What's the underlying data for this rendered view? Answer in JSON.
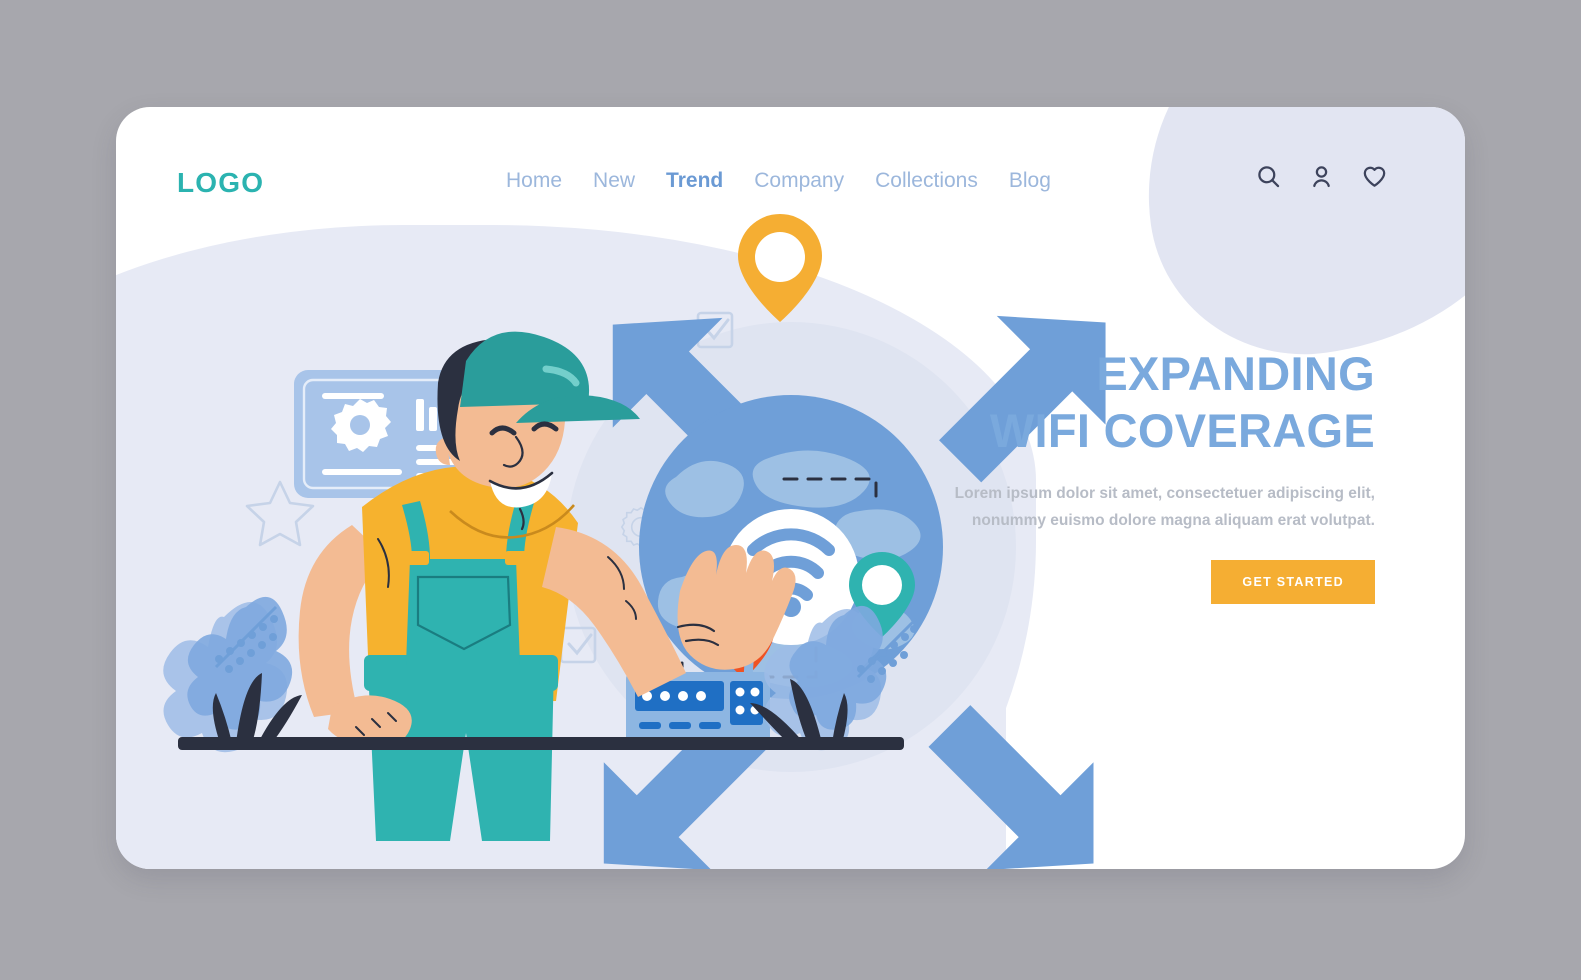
{
  "page": {
    "background_color": "#a7a7ad",
    "card_color": "#ffffff",
    "blob_color": "#e7eaf5"
  },
  "header": {
    "logo": "LOGO",
    "logo_color": "#2bb3b0",
    "nav": [
      {
        "label": "Home",
        "active": false
      },
      {
        "label": "New",
        "active": false
      },
      {
        "label": "Trend",
        "active": true
      },
      {
        "label": "Company",
        "active": false
      },
      {
        "label": "Collections",
        "active": false
      },
      {
        "label": "Blog",
        "active": false
      }
    ],
    "nav_color": "#9cb7dc",
    "nav_active_color": "#6b9ad4",
    "icons": [
      {
        "name": "search-icon",
        "label": "Search"
      },
      {
        "name": "user-icon",
        "label": "Account"
      },
      {
        "name": "heart-icon",
        "label": "Favorites"
      }
    ],
    "icon_color": "#3d435c"
  },
  "hero": {
    "title_line1": "EXPANDING",
    "title_line2": "WIFI COVERAGE",
    "title_color": "#7aa9dd",
    "body": "Lorem ipsum dolor sit amet, consectetuer adipiscing elit, nonummy euismo dolore magna aliquam erat volutpat.",
    "body_color": "#b7bcc6",
    "cta_label": "GET STARTED",
    "cta_color": "#f5ae33",
    "cta_text_color": "#ffffff"
  },
  "illustration": {
    "theme": "wifi-coverage-technician",
    "character": {
      "name": "technician",
      "cap_color": "#2a9d9b",
      "shirt_color": "#f6b22e",
      "overalls_color": "#2fb3b0",
      "skin_color": "#f3bb93"
    },
    "globe": {
      "name": "globe",
      "sphere_color": "#6f9fd8",
      "land_color": "#9dc0e4",
      "wifi_symbol_color": "#6f9fd8",
      "wifi_disc_color": "#ffffff"
    },
    "arrows": {
      "name": "four-way-expansion-arrows",
      "color": "#6f9fd8"
    },
    "pins": [
      {
        "name": "map-pin-top",
        "color": "#f5ae33"
      },
      {
        "name": "map-pin-left",
        "color": "#ef5223"
      },
      {
        "name": "map-pin-right",
        "color": "#2fb3b0"
      }
    ],
    "router": {
      "name": "wifi-router",
      "body_color": "#8db6e2",
      "panel_color": "#1f6fc4",
      "antenna_color": "#8db6e2",
      "led_count": 4
    },
    "dashboard_panel": {
      "name": "settings-dashboard-panel",
      "panel_color": "#a8c4e9",
      "gear_icon": "gear-icon",
      "bar_chart_icon": "bar-chart-icon"
    },
    "decorations": [
      {
        "name": "gear-outline-icon",
        "color": "#c6d3e8"
      },
      {
        "name": "star-outline-icon",
        "color": "#c6d3e8"
      },
      {
        "name": "checkbox-checked-icon",
        "color": "#bfd0e8",
        "count": 2
      },
      {
        "name": "pie-chart-outline-icon",
        "color": "#c6d3e8"
      },
      {
        "name": "plant-foliage",
        "color": "#9dbce6"
      },
      {
        "name": "grass-blades",
        "color": "#2b3040"
      },
      {
        "name": "ground-line",
        "color": "#2b3040"
      },
      {
        "name": "dashed-route-line",
        "color": "#2b3040"
      }
    ]
  }
}
